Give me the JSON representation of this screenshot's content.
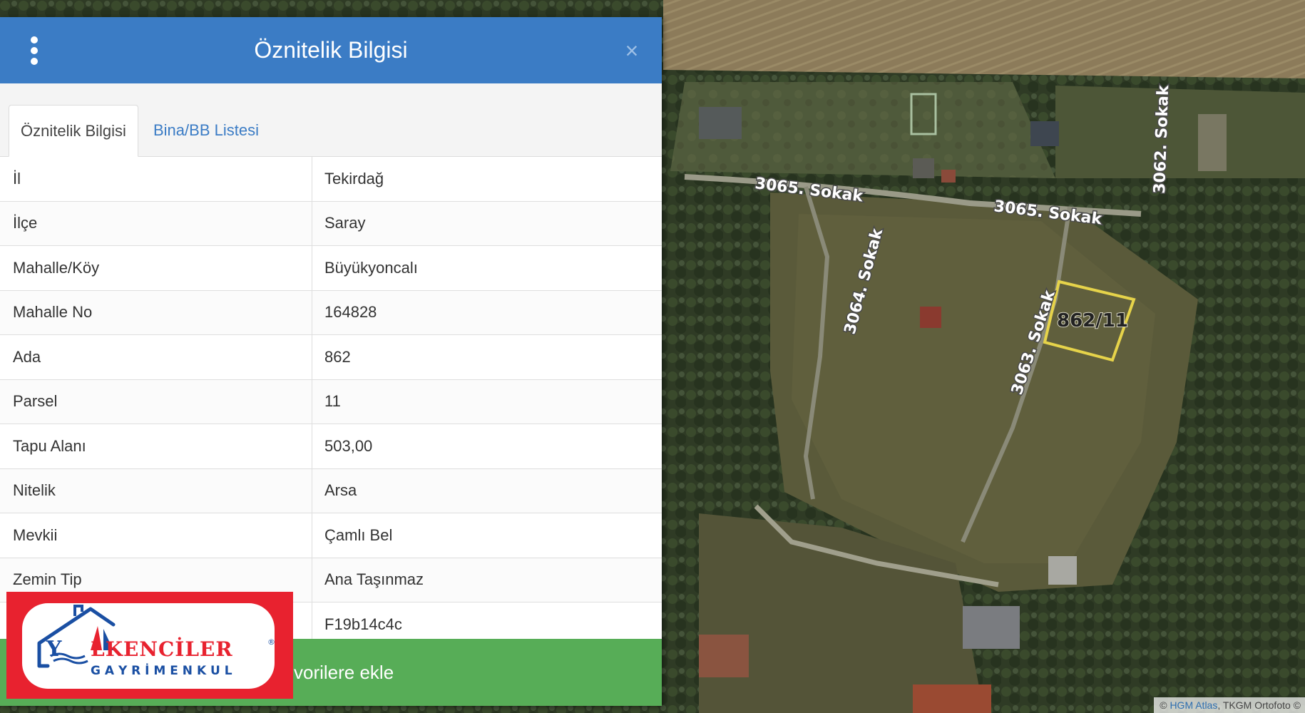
{
  "map": {
    "roads": {
      "r1": "3065. Sokak",
      "r2": "3065. Sokak",
      "r3": "3064. Sokak",
      "r4": "3063. Sokak",
      "r5": "3062. Sokak"
    },
    "parcel_label": "862/11",
    "attribution_prefix": "©",
    "attribution_link": "HGM Atlas",
    "attribution_rest": ", TKGM Ortofoto ©"
  },
  "panel": {
    "title": "Öznitelik Bilgisi",
    "close_glyph": "×",
    "tabs": [
      {
        "label": "Öznitelik Bilgisi",
        "active": true
      },
      {
        "label": "Bina/BB Listesi",
        "active": false
      }
    ],
    "rows": [
      {
        "key": "İl",
        "value": "Tekirdağ"
      },
      {
        "key": "İlçe",
        "value": "Saray"
      },
      {
        "key": "Mahalle/Köy",
        "value": "Büyükyoncalı"
      },
      {
        "key": "Mahalle No",
        "value": "164828"
      },
      {
        "key": "Ada",
        "value": "862"
      },
      {
        "key": "Parsel",
        "value": "11"
      },
      {
        "key": "Tapu Alanı",
        "value": "503,00"
      },
      {
        "key": "Nitelik",
        "value": "Arsa"
      },
      {
        "key": "Mevkii",
        "value": "Çamlı Bel"
      },
      {
        "key": "Zemin Tip",
        "value": "Ana Taşınmaz"
      },
      {
        "key": "",
        "value": "F19b14c4c"
      }
    ],
    "favorites_visible_text": "vorilere ekle"
  },
  "logo": {
    "line1_y": "Y",
    "line1_rest": "LKENCİLER",
    "registered": "®",
    "line2": "G A Y R İ M E N K U L"
  },
  "colors": {
    "header_blue": "#3b7cc5",
    "favorites_green": "#57ad57",
    "logo_red": "#e8222f",
    "logo_blue": "#1a4fa3",
    "parcel_outline": "#e6d34a"
  },
  "icons": {
    "menu": "vertical-ellipsis-icon",
    "close": "close-icon"
  }
}
